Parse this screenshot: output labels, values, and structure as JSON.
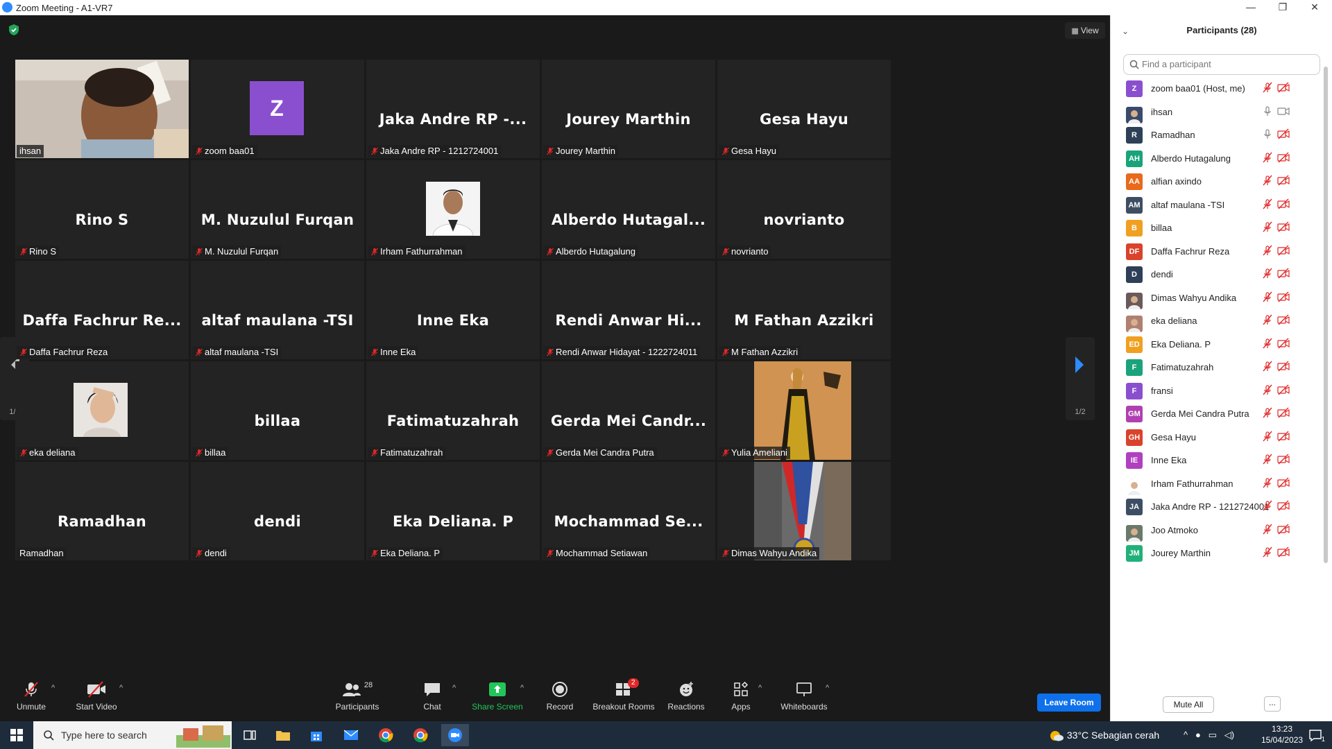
{
  "window": {
    "title": "Zoom Meeting - A1-VR7",
    "minimize": "—",
    "restore": "❐",
    "close": "✕"
  },
  "view_label": "View",
  "page_indicator": "1/2",
  "tiles": [
    {
      "name": "ihsan",
      "label": "ihsan",
      "type": "video",
      "muted": false
    },
    {
      "name": "zoom baa01",
      "label": "zoom baa01",
      "type": "avatar",
      "avatar_letter": "Z",
      "muted": true
    },
    {
      "name": "Jaka Andre RP -...",
      "label": "Jaka Andre RP - 1212724001",
      "type": "name",
      "muted": true
    },
    {
      "name": "Jourey Marthin",
      "label": "Jourey Marthin",
      "type": "name",
      "muted": true
    },
    {
      "name": "Gesa Hayu",
      "label": "Gesa Hayu",
      "type": "name",
      "muted": true
    },
    {
      "name": "Rino S",
      "label": "Rino S",
      "type": "name",
      "muted": true
    },
    {
      "name": "M. Nuzulul Furqan",
      "label": "M. Nuzulul Furqan",
      "type": "name",
      "muted": true
    },
    {
      "name": "Irham Fathurrahman",
      "label": "Irham Fathurrahman",
      "type": "photo",
      "muted": true
    },
    {
      "name": "Alberdo Hutagal...",
      "label": "Alberdo Hutagalung",
      "type": "name",
      "muted": true
    },
    {
      "name": "novrianto",
      "label": "novrianto",
      "type": "name",
      "muted": true
    },
    {
      "name": "Daffa Fachrur Re...",
      "label": "Daffa Fachrur Reza",
      "type": "name",
      "muted": true
    },
    {
      "name": "altaf maulana -TSI",
      "label": "altaf maulana -TSI",
      "type": "name",
      "muted": true
    },
    {
      "name": "Inne Eka",
      "label": "Inne Eka",
      "type": "name",
      "muted": true
    },
    {
      "name": "Rendi Anwar Hi...",
      "label": "Rendi Anwar Hidayat - 1222724011",
      "type": "name",
      "muted": true
    },
    {
      "name": "M Fathan Azzikri",
      "label": "M Fathan Azzikri",
      "type": "name",
      "muted": true
    },
    {
      "name": "eka deliana",
      "label": "eka deliana",
      "type": "photo",
      "muted": true
    },
    {
      "name": "billaa",
      "label": "billaa",
      "type": "name",
      "muted": true
    },
    {
      "name": "Fatimatuzahrah",
      "label": "Fatimatuzahrah",
      "type": "name",
      "muted": true
    },
    {
      "name": "Gerda Mei Candr...",
      "label": "Gerda Mei Candra Putra",
      "type": "name",
      "muted": true
    },
    {
      "name": "Yulia Ameliani",
      "label": "Yulia Ameliani",
      "type": "art",
      "muted": true
    },
    {
      "name": "Ramadhan",
      "label": "Ramadhan",
      "type": "name",
      "muted": false
    },
    {
      "name": "dendi",
      "label": "dendi",
      "type": "name",
      "muted": true
    },
    {
      "name": "Eka Deliana. P",
      "label": "Eka Deliana. P",
      "type": "name",
      "muted": true
    },
    {
      "name": "Mochammad Se...",
      "label": "Mochammad Setiawan",
      "type": "name",
      "muted": true
    },
    {
      "name": "Dimas Wahyu Andika",
      "label": "Dimas Wahyu Andika",
      "type": "medal",
      "muted": true
    }
  ],
  "toolbar": {
    "unmute": "Unmute",
    "start_video": "Start Video",
    "participants": "Participants",
    "participants_count": "28",
    "chat": "Chat",
    "share_screen": "Share Screen",
    "record": "Record",
    "breakout_rooms": "Breakout Rooms",
    "breakout_badge": "2",
    "reactions": "Reactions",
    "apps": "Apps",
    "whiteboards": "Whiteboards",
    "leave_room": "Leave Room"
  },
  "panel": {
    "title": "Participants (28)",
    "search_placeholder": "Find a participant",
    "mute_all": "Mute All",
    "more": "...",
    "participants": [
      {
        "initials": "Z",
        "name": "zoom baa01 (Host, me)",
        "color": "#8a4fcf",
        "mic": "muted",
        "cam": "off"
      },
      {
        "initials": "",
        "name": "ihsan",
        "color": "#3a4a6a",
        "mic": "on",
        "cam": "on",
        "photo": true
      },
      {
        "initials": "R",
        "name": "Ramadhan",
        "color": "#2e4057",
        "mic": "on",
        "cam": "off"
      },
      {
        "initials": "AH",
        "name": "Alberdo Hutagalung",
        "color": "#1aa37a",
        "mic": "muted",
        "cam": "off"
      },
      {
        "initials": "AA",
        "name": "alfian axindo",
        "color": "#e86a1a",
        "mic": "muted",
        "cam": "off"
      },
      {
        "initials": "AM",
        "name": "altaf maulana -TSI",
        "color": "#3e4e62",
        "mic": "muted",
        "cam": "off"
      },
      {
        "initials": "B",
        "name": "billaa",
        "color": "#f0a020",
        "mic": "muted",
        "cam": "off"
      },
      {
        "initials": "DF",
        "name": "Daffa Fachrur Reza",
        "color": "#d9432b",
        "mic": "muted",
        "cam": "off"
      },
      {
        "initials": "D",
        "name": "dendi",
        "color": "#2e4057",
        "mic": "muted",
        "cam": "off"
      },
      {
        "initials": "",
        "name": "Dimas Wahyu Andika",
        "color": "#6a5a5a",
        "mic": "muted",
        "cam": "off",
        "photo": true
      },
      {
        "initials": "",
        "name": "eka deliana",
        "color": "#b08070",
        "mic": "muted",
        "cam": "off",
        "photo": true
      },
      {
        "initials": "ED",
        "name": "Eka Deliana. P",
        "color": "#f0a020",
        "mic": "muted",
        "cam": "off"
      },
      {
        "initials": "F",
        "name": "Fatimatuzahrah",
        "color": "#1aa37a",
        "mic": "muted",
        "cam": "off"
      },
      {
        "initials": "F",
        "name": "fransi",
        "color": "#8a4fcf",
        "mic": "muted",
        "cam": "off"
      },
      {
        "initials": "GM",
        "name": "Gerda Mei Candra Putra",
        "color": "#b040b0",
        "mic": "muted",
        "cam": "off"
      },
      {
        "initials": "GH",
        "name": "Gesa Hayu",
        "color": "#d9432b",
        "mic": "muted",
        "cam": "off"
      },
      {
        "initials": "IE",
        "name": "Inne Eka",
        "color": "#b040c0",
        "mic": "muted",
        "cam": "off"
      },
      {
        "initials": "",
        "name": "Irham Fathurrahman",
        "color": "#ffffff",
        "mic": "muted",
        "cam": "off",
        "photo": true
      },
      {
        "initials": "JA",
        "name": "Jaka Andre RP - 1212724001",
        "color": "#3e4e62",
        "mic": "muted",
        "cam": "off"
      },
      {
        "initials": "",
        "name": "Joo Atmoko",
        "color": "#6a7a6a",
        "mic": "muted",
        "cam": "off",
        "photo": true
      },
      {
        "initials": "JM",
        "name": "Jourey Marthin",
        "color": "#22b07a",
        "mic": "muted",
        "cam": "off"
      }
    ]
  },
  "taskbar": {
    "search_placeholder": "Type here to search",
    "weather": "33°C  Sebagian cerah",
    "time": "13:23",
    "date": "15/04/2023",
    "notification_count": "1"
  }
}
